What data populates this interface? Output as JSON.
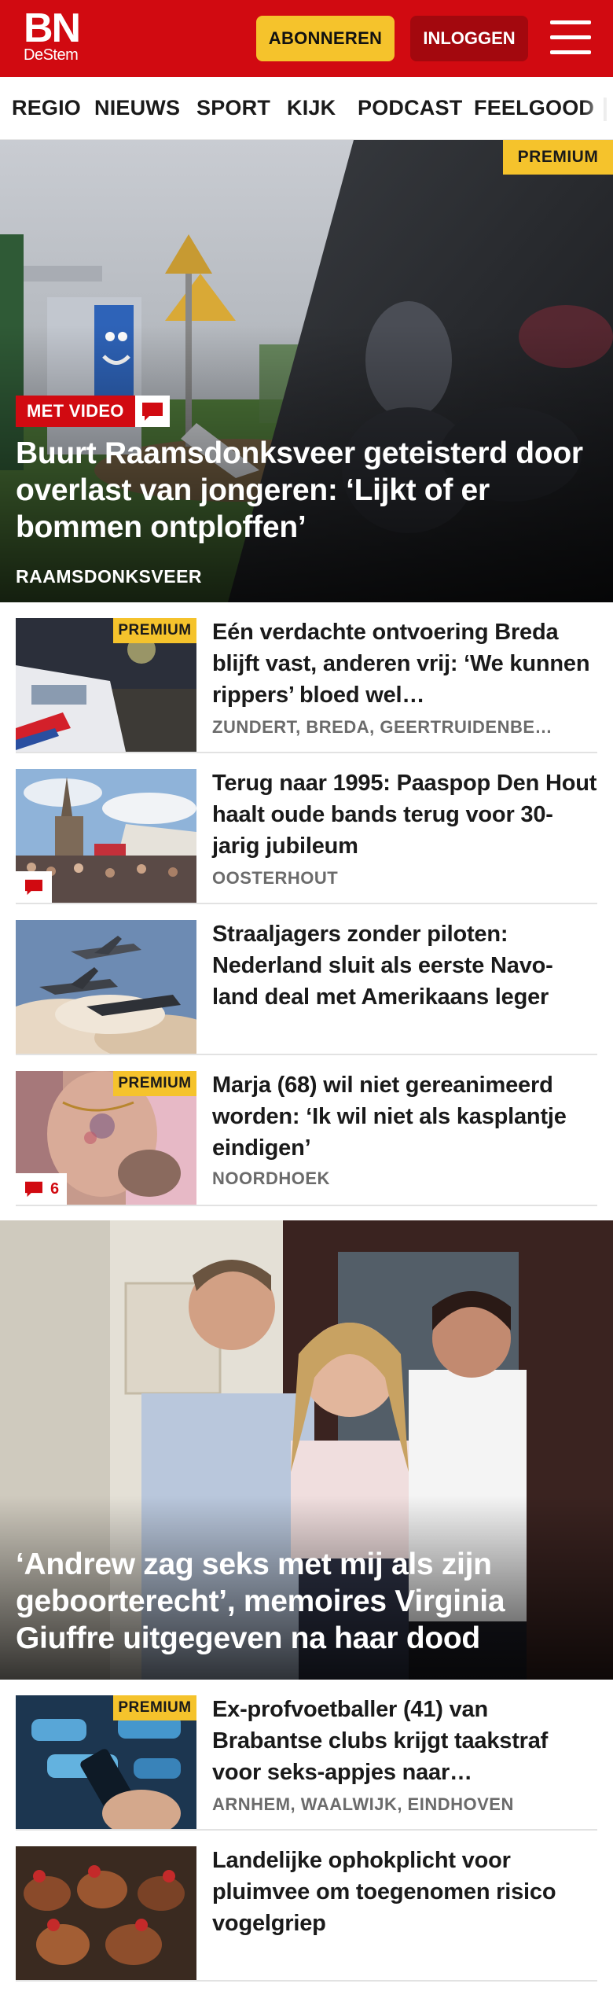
{
  "header": {
    "logo_main": "BN",
    "logo_sub": "DeStem",
    "subscribe_label": "ABONNEREN",
    "login_label": "INLOGGEN",
    "menu_icon": "hamburger-menu-icon"
  },
  "nav": {
    "items": [
      {
        "label": "REGIO"
      },
      {
        "label": "NIEUWS"
      },
      {
        "label": "SPORT"
      },
      {
        "label": "KIJK"
      },
      {
        "label": "PODCAST"
      },
      {
        "label": "FEELGOOD"
      }
    ]
  },
  "hero1": {
    "badge": "PREMIUM",
    "video_label": "MET VIDEO",
    "comment_icon": "comment-icon",
    "title": "Buurt Raamsdonksveer geteisterd door overlast van jongeren: ‘Lijkt of er bommen ontploffen’",
    "location": "RAAMSDONKSVEER"
  },
  "articles": [
    {
      "badge": "PREMIUM",
      "title": "Eén verdachte ontvoering Breda blijft vast, anderen vrij: ‘We kunnen rippers’ bloed wel…",
      "location": "ZUNDERT, BREDA, GEERTRUIDENBE…"
    },
    {
      "title": "Terug naar 1995: Paaspop Den Hout haalt oude bands terug voor 30-jarig jubileum",
      "location": "OOSTERHOUT",
      "comment_icon": "comment-icon"
    },
    {
      "title": "Straaljagers zonder piloten: Nederland sluit als eerste Navo-land deal met Amerikaans leger"
    },
    {
      "badge": "PREMIUM",
      "title": "Marja (68) wil niet gereanimeerd worden: ‘Ik wil niet als kasplantje eindigen’",
      "location": "NOORDHOEK",
      "comment_count": "6"
    }
  ],
  "hero2": {
    "title": "‘Andrew zag seks met mij als zijn geboorterecht’, memoires Virginia Giuffre uitgegeven na haar dood"
  },
  "articles2": [
    {
      "badge": "PREMIUM",
      "title": "Ex-profvoetballer (41) van Brabantse clubs krijgt taakstraf voor seks-appjes naar…",
      "location": "ARNHEM, WAALWIJK, EINDHOVEN"
    },
    {
      "title": "Landelijke ophokplicht voor pluimvee om toegenomen risico vogelgriep"
    }
  ],
  "colors": {
    "brand_red": "#d10a11",
    "premium_yellow": "#f5c32c",
    "login_dark_red": "#a3080e",
    "location_gray": "#6b6b6b"
  }
}
